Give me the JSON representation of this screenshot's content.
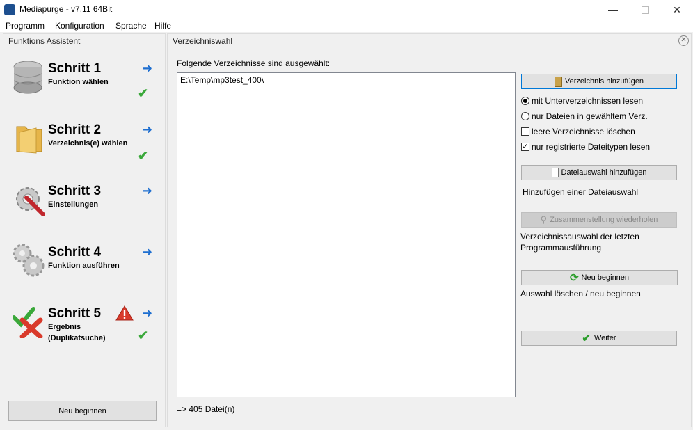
{
  "window": {
    "title": "Mediapurge - v7.11 64Bit"
  },
  "menu": [
    "Programm",
    "Konfiguration",
    "Sprache",
    "Hilfe"
  ],
  "left": {
    "title": "Funktions Assistent",
    "steps": [
      {
        "title": "Schritt 1",
        "sub": "Funktion wählen",
        "icon": "database-icon",
        "check": true,
        "warn": false
      },
      {
        "title": "Schritt 2",
        "sub": "Verzeichnis(e) wählen",
        "icon": "folder-icon",
        "check": true,
        "warn": false
      },
      {
        "title": "Schritt 3",
        "sub": "Einstellungen",
        "icon": "settings-gear-icon",
        "check": false,
        "warn": false
      },
      {
        "title": "Schritt 4",
        "sub": "Funktion ausführen",
        "icon": "gears-icon",
        "check": false,
        "warn": false
      },
      {
        "title": "Schritt 5",
        "sub": "Ergebnis (Duplikatsuche)",
        "icon": "result-check-cross-icon",
        "check": true,
        "warn": true
      }
    ],
    "restart_button": "Neu beginnen"
  },
  "right": {
    "title": "Verzeichniswahl",
    "selected_label": "Folgende Verzeichnisse sind ausgewählt:",
    "directories": [
      "E:\\Temp\\mp3test_400\\"
    ],
    "file_count": "=> 405 Datei(n)",
    "add_dir_button": "Verzeichnis hinzufügen",
    "radio_subdirs": "mit Unterverzeichnissen lesen",
    "radio_only_files": "nur Dateien in gewähltem Verz.",
    "check_empty_dirs": "leere Verzeichnisse löschen",
    "check_registered": "nur registrierte Dateitypen lesen",
    "add_selection_button": "Dateiauswahl hinzufügen",
    "add_selection_desc": "Hinzufügen einer Dateiauswahl",
    "repeat_button": "Zusammenstellung wiederholen",
    "repeat_desc": "Verzeichnissauswahl der letzten Programmausführung",
    "restart_button": "Neu beginnen",
    "restart_desc": "Auswahl löschen / neu beginnen",
    "next_button": "Weiter"
  },
  "colors": {
    "accent_arrow": "#1f6fd0",
    "check_green": "#3aa83a",
    "warn_red": "#d93a2b"
  }
}
